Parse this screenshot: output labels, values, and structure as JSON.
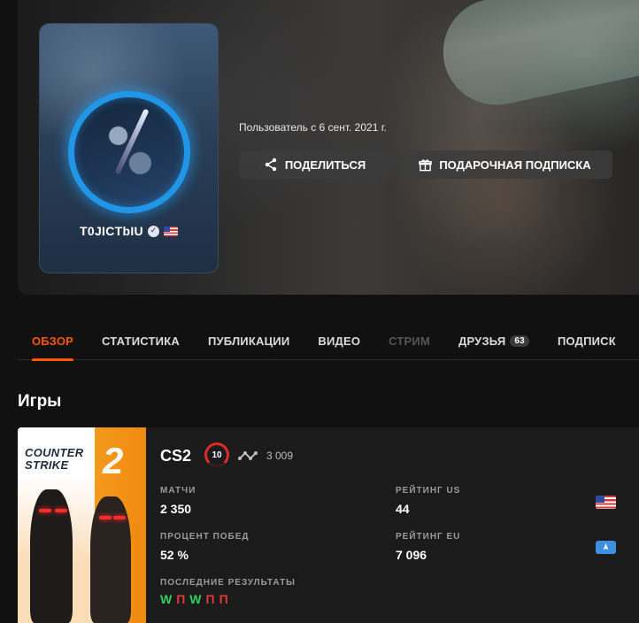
{
  "profile": {
    "username": "T0JICTbIU",
    "verified_icon": "verified-check-icon",
    "country_flag_icon": "us-flag-icon",
    "member_since": "Пользователь с 6 сент. 2021 г."
  },
  "actions": {
    "share_label": "ПОДЕЛИТЬСЯ",
    "gift_label": "ПОДАРОЧНАЯ ПОДПИСКА"
  },
  "tabs": [
    {
      "label": "ОБЗОР",
      "active": true
    },
    {
      "label": "СТАТИСТИКА"
    },
    {
      "label": "ПУБЛИКАЦИИ"
    },
    {
      "label": "ВИДЕО"
    },
    {
      "label": "СТРИМ",
      "disabled": true
    },
    {
      "label": "ДРУЗЬЯ",
      "badge": "63"
    },
    {
      "label": "ПОДПИСК"
    }
  ],
  "games_section": {
    "title": "Игры",
    "game": {
      "cover_title": "COUNTER STRIKE",
      "cover_number": "2",
      "name": "CS2",
      "level": "10",
      "elo": "3 009",
      "matches_label": "МАТЧИ",
      "matches_value": "2 350",
      "winrate_label": "ПРОЦЕНТ ПОБЕД",
      "winrate_value": "52 %",
      "rating_us_label": "РЕЙТИНГ US",
      "rating_us_value": "44",
      "rating_eu_label": "РЕЙТИНГ EU",
      "rating_eu_value": "7 096",
      "recent_label": "ПОСЛЕДНИЕ РЕЗУЛЬТАТЫ",
      "recent_results": [
        "W",
        "П",
        "W",
        "П",
        "П"
      ]
    }
  },
  "colors": {
    "accent": "#ff5500",
    "win": "#2fd35a",
    "loss": "#e23a3a",
    "level_ring": "#e02a2a"
  }
}
